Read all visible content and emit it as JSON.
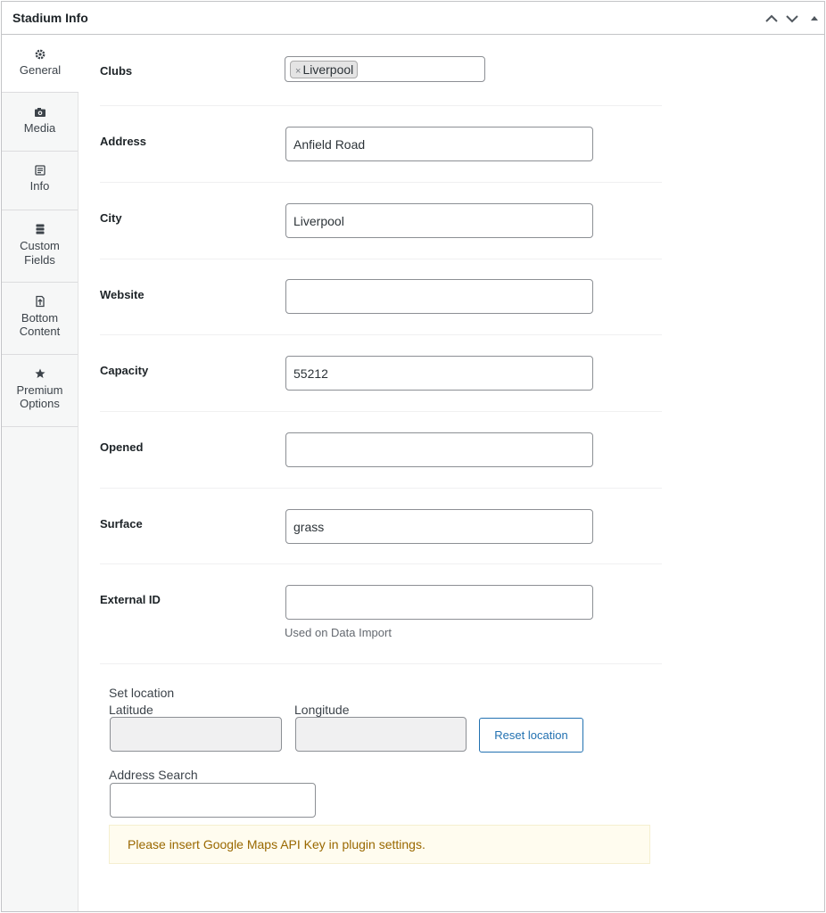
{
  "header": {
    "title": "Stadium Info"
  },
  "tabs": [
    {
      "label": "General",
      "icon": "gear-icon"
    },
    {
      "label": "Media",
      "icon": "camera-icon"
    },
    {
      "label": "Info",
      "icon": "info-doc-icon"
    },
    {
      "label1": "Custom",
      "label2": "Fields",
      "icon": "database-icon"
    },
    {
      "label1": "Bottom",
      "label2": "Content",
      "icon": "document-arrow-icon"
    },
    {
      "label1": "Premium",
      "label2": "Options",
      "icon": "star-icon"
    }
  ],
  "fields": {
    "clubs": {
      "label": "Clubs",
      "chip": "Liverpool",
      "remove": "×"
    },
    "address": {
      "label": "Address",
      "value": "Anfield Road"
    },
    "city": {
      "label": "City",
      "value": "Liverpool"
    },
    "website": {
      "label": "Website",
      "value": ""
    },
    "capacity": {
      "label": "Capacity",
      "value": "55212"
    },
    "opened": {
      "label": "Opened",
      "value": ""
    },
    "surface": {
      "label": "Surface",
      "value": "grass"
    },
    "external_id": {
      "label": "External ID",
      "value": "",
      "description": "Used on Data Import"
    }
  },
  "location": {
    "title": "Set location",
    "latitude_label": "Latitude",
    "longitude_label": "Longitude",
    "reset_label": "Reset location",
    "search_label": "Address Search",
    "notice": "Please insert Google Maps API Key in plugin settings."
  }
}
